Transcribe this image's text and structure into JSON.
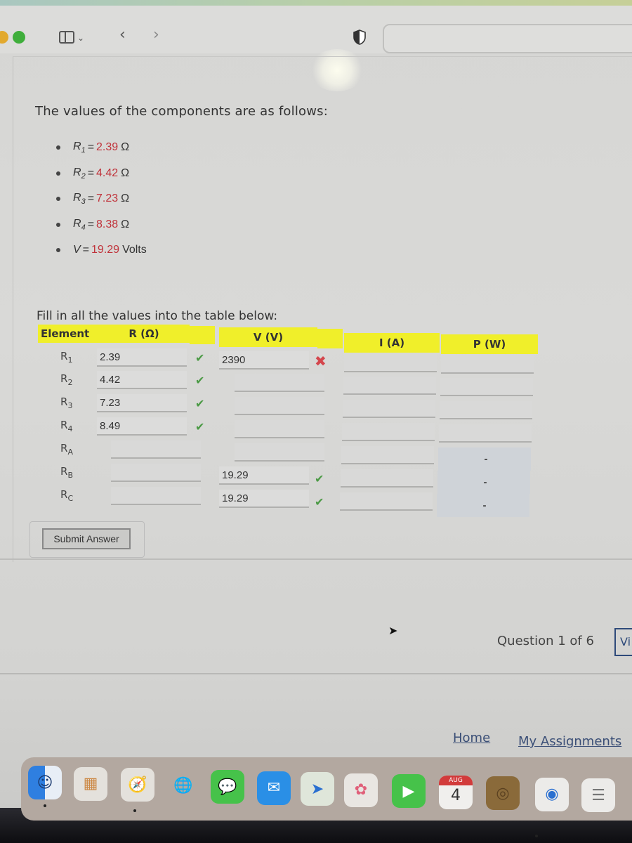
{
  "browser": {
    "toolbar_icons": [
      "sidebar-icon",
      "chevron-down-icon",
      "back-icon",
      "forward-icon",
      "shield-icon"
    ],
    "url": ""
  },
  "problem": {
    "intro": "The values of the components are as follows:",
    "components": [
      {
        "name": "R",
        "sub": "1",
        "value": "2.39",
        "unit": "Ω"
      },
      {
        "name": "R",
        "sub": "2",
        "value": "4.42",
        "unit": "Ω"
      },
      {
        "name": "R",
        "sub": "3",
        "value": "7.23",
        "unit": "Ω"
      },
      {
        "name": "R",
        "sub": "4",
        "value": "8.38",
        "unit": "Ω"
      },
      {
        "name": "V",
        "sub": "",
        "value": "19.29",
        "unit": "Volts"
      }
    ],
    "fill_instruction": "Fill in all the values into the table below:"
  },
  "table": {
    "headers": {
      "element": "Element",
      "r": "R (Ω)",
      "v": "V (V)",
      "i": "I (A)",
      "p": "P (W)"
    },
    "rows": [
      {
        "label": "R",
        "sub": "1",
        "r": "2.39",
        "r_status": "correct",
        "v": "2390",
        "v_status": "incorrect",
        "i": "",
        "p": ""
      },
      {
        "label": "R",
        "sub": "2",
        "r": "4.42",
        "r_status": "correct",
        "v": "",
        "v_status": "",
        "i": "",
        "p": ""
      },
      {
        "label": "R",
        "sub": "3",
        "r": "7.23",
        "r_status": "correct",
        "v": "",
        "v_status": "",
        "i": "",
        "p": ""
      },
      {
        "label": "R",
        "sub": "4",
        "r": "8.49",
        "r_status": "correct",
        "v": "",
        "v_status": "",
        "i": "",
        "p": ""
      },
      {
        "label": "R",
        "sub": "A",
        "r": "",
        "r_status": "",
        "v": "",
        "v_status": "",
        "i": "",
        "p": "-"
      },
      {
        "label": "R",
        "sub": "B",
        "r": "",
        "r_status": "",
        "v": "19.29",
        "v_status": "correct",
        "i": "",
        "p": "-"
      },
      {
        "label": "R",
        "sub": "C",
        "r": "",
        "r_status": "",
        "v": "19.29",
        "v_status": "correct",
        "i": "",
        "p": "-"
      }
    ],
    "status_marks": {
      "correct": "✔",
      "incorrect": "✖"
    }
  },
  "actions": {
    "submit_label": "Submit Answer"
  },
  "navigation": {
    "question_counter": "Question 1 of 6",
    "view_button_partial": "Vi",
    "home_link": "Home",
    "assignments_link": "My Assignments"
  },
  "dock": {
    "apps": [
      "finder",
      "launchpad",
      "safari",
      "network",
      "messages",
      "mail",
      "maps",
      "photos",
      "facetime",
      "calendar",
      "photo-booth",
      "chrome",
      "reminders"
    ],
    "calendar_month": "AUG",
    "calendar_day": "4"
  }
}
